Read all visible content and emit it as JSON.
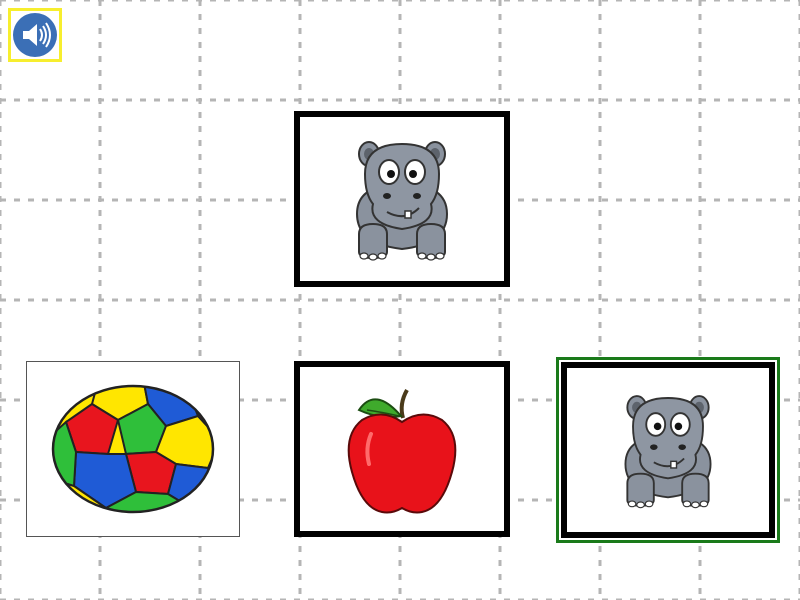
{
  "colors": {
    "grid_line": "#b5b5b5",
    "sound_button_bg": "#3b6fb6",
    "sound_button_highlight": "#f7ee2e",
    "selected_border": "#1a7a1a",
    "card_border": "#000000"
  },
  "sound_button": {
    "icon": "speaker-icon"
  },
  "prompt": {
    "icon": "hippo-icon"
  },
  "choices": [
    {
      "icon": "soccer-ball-icon"
    },
    {
      "icon": "apple-icon"
    },
    {
      "icon": "hippo-icon",
      "selected": true
    }
  ]
}
